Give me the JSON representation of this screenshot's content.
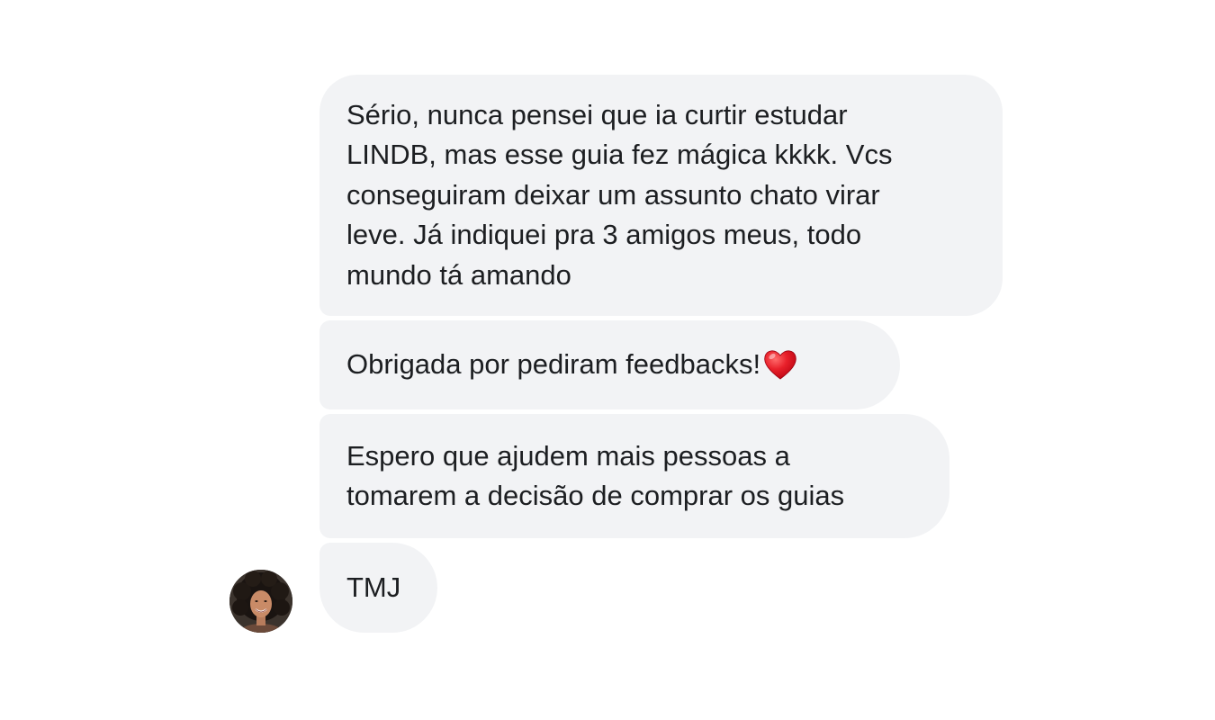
{
  "messages": [
    {
      "text": "Sério, nunca pensei que ia curtir estudar\nLINDB, mas esse guia fez mágica kkkk. Vcs\nconseguiram deixar um assunto chato virar\nleve. Já indiquei pra 3 amigos meus, todo\nmundo tá amando"
    },
    {
      "text": "Obrigada por pediram feedbacks!",
      "emoji": "heart-icon"
    },
    {
      "text": "Espero que ajudem mais pessoas a\ntomarem a decisão de comprar os guias"
    },
    {
      "text": "TMJ"
    }
  ],
  "sender": {
    "avatar": "avatar-photo"
  },
  "colors": {
    "bubble_background": "#f2f3f5",
    "text": "#1c1e21",
    "heart": "#e0101e",
    "page_background": "#ffffff"
  }
}
